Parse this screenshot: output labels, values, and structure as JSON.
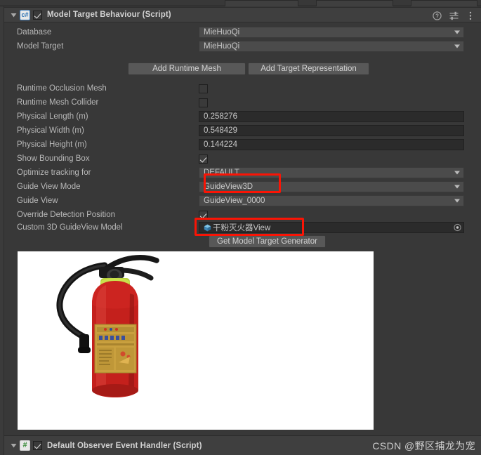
{
  "window": {
    "background_color": "#383838",
    "panel_color": "#3f3f3f"
  },
  "components": [
    {
      "title": "Model Target Behaviour (Script)",
      "icon": "csharp-script-icon",
      "enabled": true,
      "expanded": true
    },
    {
      "title": "Default Observer Event Handler (Script)",
      "icon": "hash-script-icon",
      "enabled": true,
      "expanded": true
    }
  ],
  "header_tools": [
    {
      "name": "help-icon",
      "glyph": "?"
    },
    {
      "name": "preset-icon",
      "glyph": "preset"
    },
    {
      "name": "more-menu-icon",
      "glyph": "⋮"
    }
  ],
  "properties": [
    {
      "label": "Database",
      "type": "popup",
      "value": "MieHuoQi"
    },
    {
      "label": "Model Target",
      "type": "popup",
      "value": "MieHuoQi"
    },
    {
      "label": "Runtime Occlusion Mesh",
      "type": "checkbox",
      "value": false
    },
    {
      "label": "Runtime Mesh Collider",
      "type": "checkbox",
      "value": false
    },
    {
      "label": "Physical Length (m)",
      "type": "text",
      "value": "0.258276"
    },
    {
      "label": "Physical Width (m)",
      "type": "text",
      "value": "0.548429"
    },
    {
      "label": "Physical Height (m)",
      "type": "text",
      "value": "0.144224"
    },
    {
      "label": "Show Bounding Box",
      "type": "checkbox",
      "value": true
    },
    {
      "label": "Optimize tracking for",
      "type": "popup",
      "value": "DEFAULT"
    },
    {
      "label": "Guide View Mode",
      "type": "popup",
      "value": "GuideView3D"
    },
    {
      "label": "Guide View",
      "type": "popup",
      "value": "GuideView_0000"
    },
    {
      "label": "Override Detection Position",
      "type": "checkbox",
      "value": true
    },
    {
      "label": "Custom 3D GuideView Model",
      "type": "object",
      "value": "干粉灭火器View"
    }
  ],
  "buttons": {
    "add_runtime_mesh": "Add Runtime Mesh",
    "add_target_representation": "Add Target Representation",
    "get_model_target_generator": "Get Model Target Generator"
  },
  "annotations": {
    "highlight_color": "#fa1405",
    "boxes": [
      {
        "name": "guide-view-mode-highlight",
        "target": "Guide View Mode"
      },
      {
        "name": "custom-3d-guideview-model-highlight",
        "target": "Custom 3D GuideView Model"
      }
    ]
  },
  "preview": {
    "name": "model-preview",
    "background_color": "#ffffff",
    "subject": "red dry-powder fire extinguisher with black hose and gold label"
  },
  "watermark": {
    "text": "CSDN @野区捕龙为宠"
  }
}
